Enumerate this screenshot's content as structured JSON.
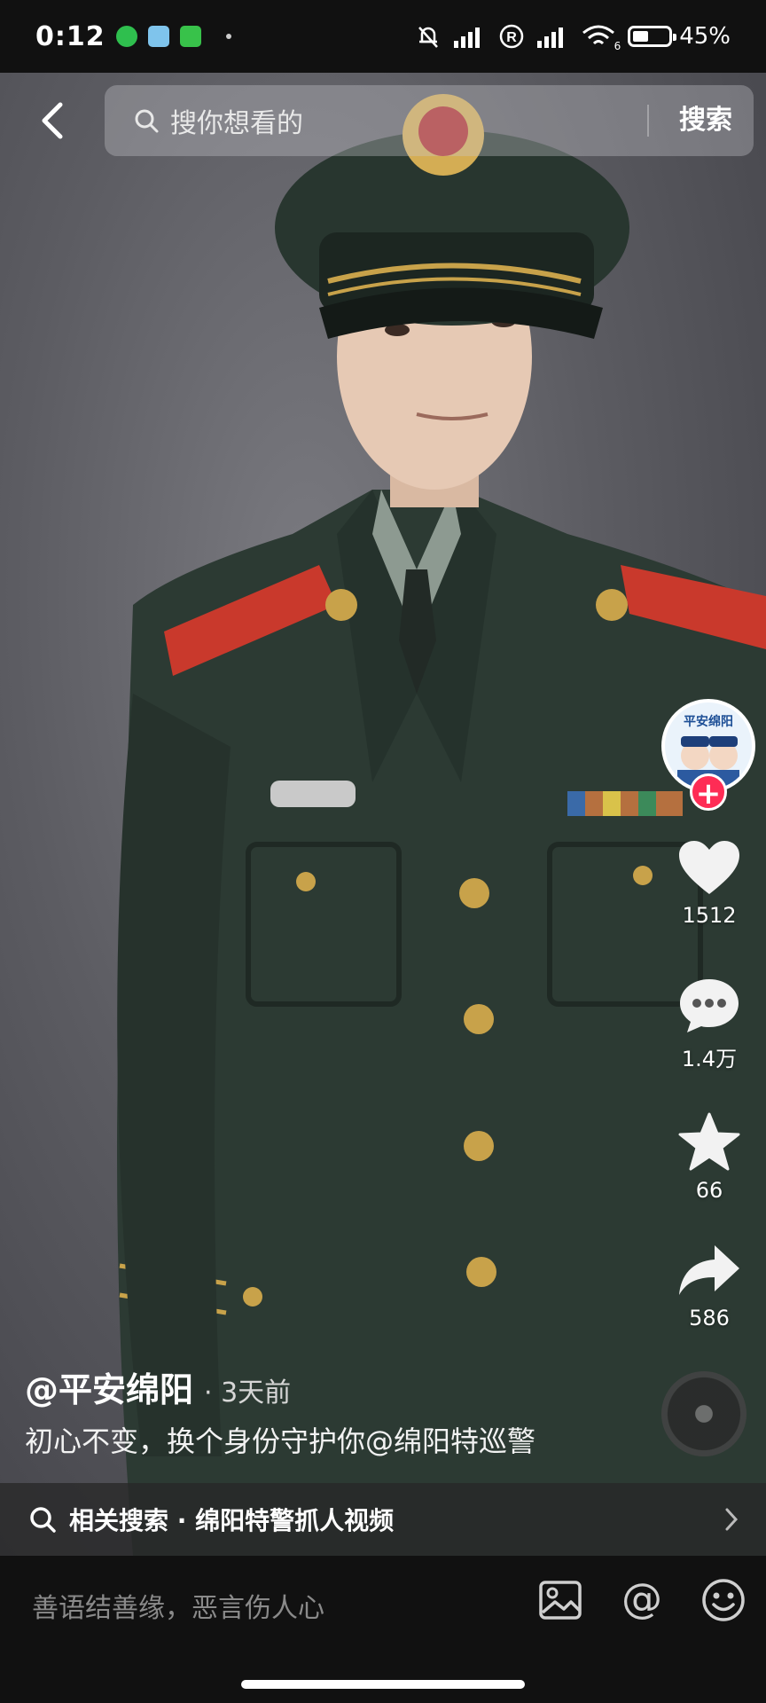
{
  "status_bar": {
    "time": "0:12",
    "battery_percent_label": "45%",
    "battery_level": 0.45,
    "network_badge": "6"
  },
  "header": {
    "search_placeholder": "搜你想看的",
    "search_button": "搜索"
  },
  "avatar": {
    "badge_text": "平安绵阳"
  },
  "actions": {
    "like_count": "1512",
    "comment_count": "1.4万",
    "favorite_count": "66",
    "share_count": "586"
  },
  "post": {
    "author": "@平安绵阳",
    "time": "· 3天前",
    "caption": "初心不变，换个身份守护你@绵阳特巡警"
  },
  "related_search": {
    "label": "相关搜索 · 绵阳特警抓人视频"
  },
  "comment_bar": {
    "placeholder": "善语结善缘，恶言伤人心"
  },
  "colors": {
    "accent_follow": "#fe2c55",
    "uniform": "#2c3a33",
    "epaulette": "#c9392c",
    "background_video": "#5c5c62"
  }
}
